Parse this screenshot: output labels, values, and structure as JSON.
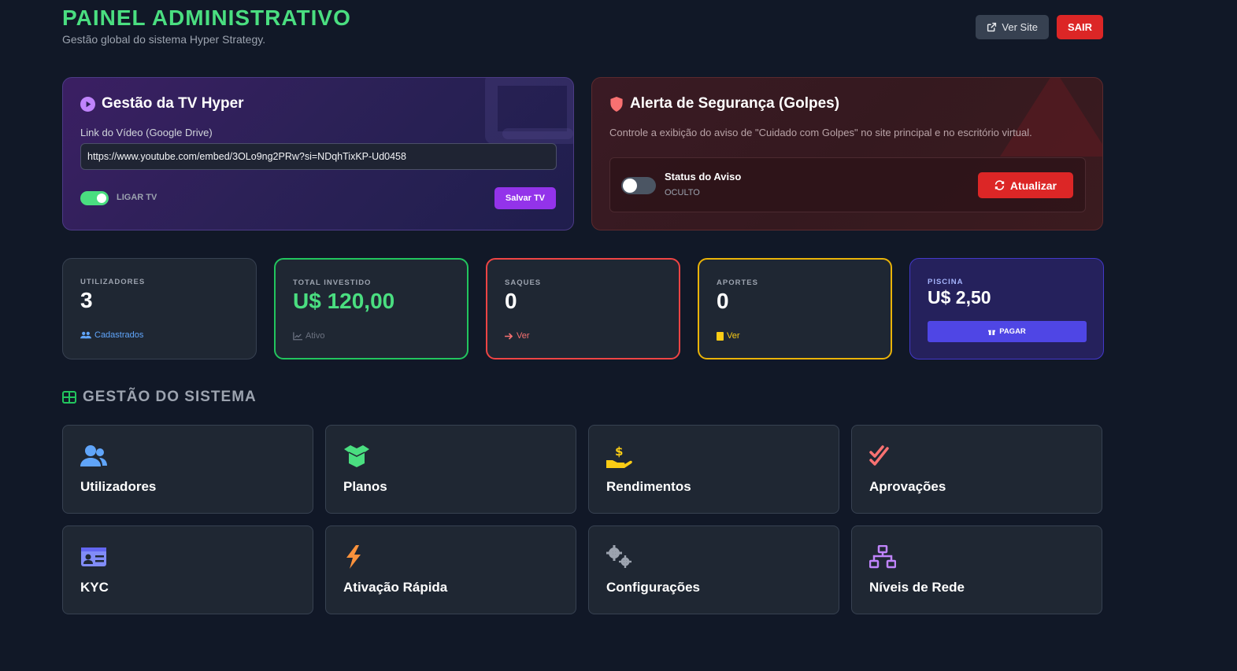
{
  "header": {
    "title": "PAINEL ADMINISTRATIVO",
    "subtitle": "Gestão global do sistema Hyper Strategy.",
    "ver_site_label": "Ver Site",
    "sair_label": "SAIR"
  },
  "tv_panel": {
    "title": "Gestão da TV Hyper",
    "link_label": "Link do Vídeo (Google Drive)",
    "link_value": "https://www.youtube.com/embed/3OLo9ng2PRw?si=NDqhTixKP-Ud0458",
    "toggle_label": "LIGAR TV",
    "toggle_on": true,
    "save_label": "Salvar TV"
  },
  "alert_panel": {
    "title": "Alerta de Segurança (Golpes)",
    "description": "Controle a exibição do aviso de \"Cuidado com Golpes\" no site principal e no escritório virtual.",
    "status_title": "Status do Aviso",
    "status_value": "OCULTO",
    "toggle_on": false,
    "update_label": "Atualizar"
  },
  "stats": [
    {
      "label": "UTILIZADORES",
      "value": "3",
      "footer": "Cadastrados",
      "footer_icon": "users-icon",
      "footer_color": "#60a5fa"
    },
    {
      "label": "TOTAL INVESTIDO",
      "value": "U$ 120,00",
      "footer": "Ativo",
      "footer_icon": "chart-line-icon",
      "footer_color": "#6b7280"
    },
    {
      "label": "SAQUES",
      "value": "0",
      "footer": "Ver",
      "footer_icon": "arrow-right-icon",
      "footer_color": "#f87171"
    },
    {
      "label": "APORTES",
      "value": "0",
      "footer": "Ver",
      "footer_icon": "clipboard-icon",
      "footer_color": "#facc15"
    },
    {
      "label": "PISCINA",
      "value": "U$ 2,50",
      "button": "PAGAR",
      "button_icon": "gift-icon"
    }
  ],
  "section": {
    "title": "GESTÃO DO SISTEMA",
    "tiles": [
      {
        "label": "Utilizadores",
        "icon": "users-icon",
        "color": "#60a5fa"
      },
      {
        "label": "Planos",
        "icon": "box-open-icon",
        "color": "#4ade80"
      },
      {
        "label": "Rendimentos",
        "icon": "hand-dollar-icon",
        "color": "#facc15"
      },
      {
        "label": "Aprovações",
        "icon": "double-check-icon",
        "color": "#f87171"
      },
      {
        "label": "KYC",
        "icon": "id-card-icon",
        "color": "#818cf8"
      },
      {
        "label": "Ativação Rápida",
        "icon": "bolt-icon",
        "color": "#fb923c"
      },
      {
        "label": "Configurações",
        "icon": "gears-icon",
        "color": "#9ca3af"
      },
      {
        "label": "Níveis de Rede",
        "icon": "sitemap-icon",
        "color": "#c084fc"
      }
    ]
  },
  "colors": {
    "background": "#111827",
    "accent_green": "#4ade80",
    "danger": "#dc2626",
    "purple": "#9333ea",
    "indigo": "#4f46e5"
  }
}
